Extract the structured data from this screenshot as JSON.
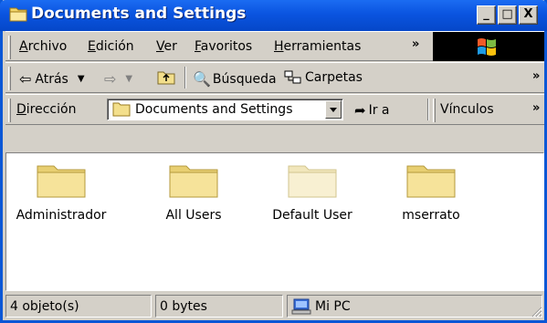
{
  "window": {
    "title": "Documents and Settings"
  },
  "caption_buttons": {
    "minimize": "_",
    "maximize": "□",
    "close": "X"
  },
  "menu": {
    "items": [
      {
        "pre": "",
        "key": "A",
        "post": "rchivo"
      },
      {
        "pre": "",
        "key": "E",
        "post": "dición"
      },
      {
        "pre": "",
        "key": "V",
        "post": "er"
      },
      {
        "pre": "",
        "key": "F",
        "post": "avoritos"
      },
      {
        "pre": "",
        "key": "H",
        "post": "erramientas"
      }
    ],
    "overflow": "»"
  },
  "toolbar": {
    "back_label": "Atrás",
    "search_label": "Búsqueda",
    "folders_label": "Carpetas",
    "overflow": "»"
  },
  "address": {
    "label_key": "D",
    "label_rest": "irección",
    "value": "Documents and Settings",
    "go_label": "Ir a",
    "links_label": "Vínculos",
    "overflow": "»"
  },
  "folders": [
    {
      "name": "Administrador",
      "style": "normal"
    },
    {
      "name": "All Users",
      "style": "normal"
    },
    {
      "name": "Default User",
      "style": "faded"
    },
    {
      "name": "mserrato",
      "style": "normal"
    }
  ],
  "status": {
    "objects": "4 objeto(s)",
    "size": "0 bytes",
    "location": "Mi PC"
  },
  "colors": {
    "titlebar": "#0a54e0",
    "window_face": "#d4d0c8",
    "folder_fill": "#f3df8c",
    "folder_faded": "#f6ecc4"
  }
}
